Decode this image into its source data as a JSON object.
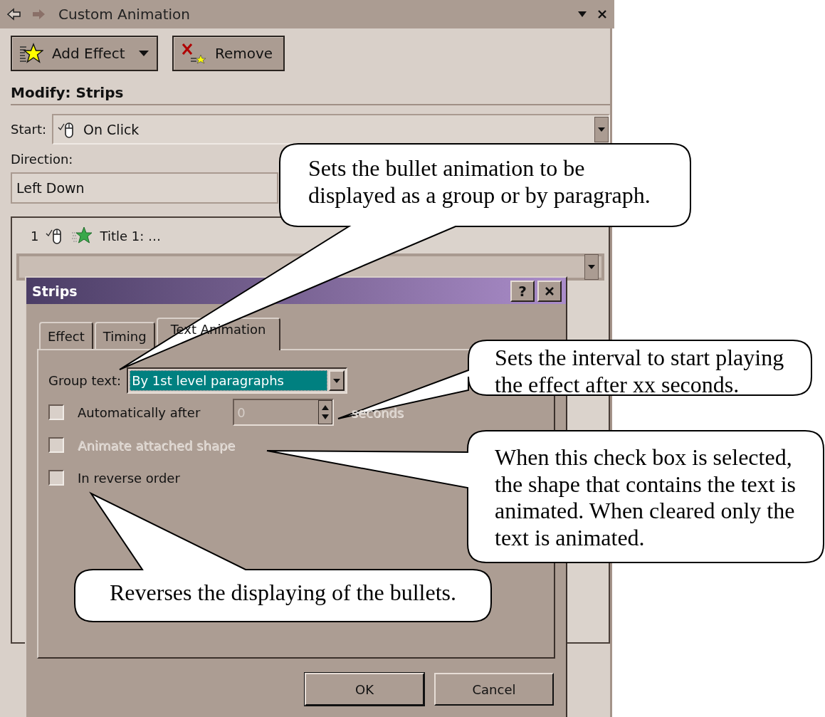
{
  "panel": {
    "title": "Custom Animation",
    "buttons": [
      {
        "label": "Add Effect",
        "kind": "add"
      },
      {
        "label": "Remove",
        "kind": "remove"
      }
    ],
    "modify_heading": "Modify: Strips",
    "start": {
      "label": "Start:",
      "value": "On Click"
    },
    "direction": {
      "label": "Direction:",
      "value": "Left Down"
    },
    "effects": [
      {
        "order": "1",
        "name": "Title 1: …"
      }
    ]
  },
  "dialog": {
    "title": "Strips",
    "help_button": "?",
    "tabs": [
      {
        "label": "Effect",
        "selected": false
      },
      {
        "label": "Timing",
        "selected": false
      },
      {
        "label": "Text Animation",
        "selected": true
      }
    ],
    "group_text": {
      "label": "Group text:",
      "value": "By 1st level paragraphs"
    },
    "options": [
      {
        "kind": "spin",
        "label": "Automatically after",
        "checked": false,
        "disabled": false,
        "value": "0",
        "field_disabled": true,
        "unit": "seconds"
      },
      {
        "kind": "check",
        "label": "Animate attached shape",
        "checked": false,
        "disabled": true
      },
      {
        "kind": "check",
        "label": "In reverse order",
        "checked": false,
        "disabled": false
      }
    ],
    "buttons": [
      "OK",
      "Cancel"
    ]
  },
  "callouts": [
    {
      "text": "Sets the bullet animation to be displayed as a group or by paragraph."
    },
    {
      "text": "Sets the interval to start playing the effect after xx seconds."
    },
    {
      "text": "When this check box is selected, the shape that contains the text is animated. When cleared only the text is animated."
    },
    {
      "text": "Reverses the displaying of the bullets."
    }
  ]
}
